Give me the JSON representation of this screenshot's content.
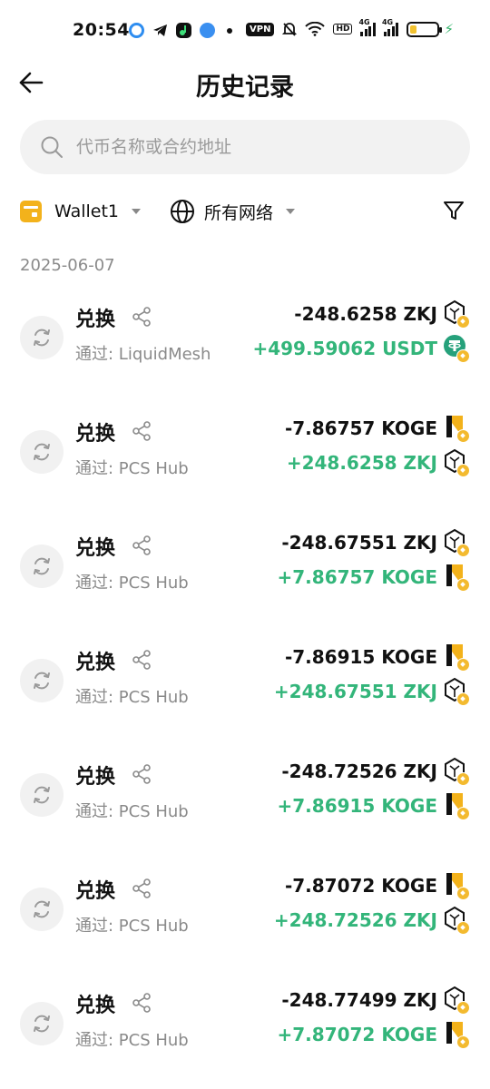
{
  "status_bar": {
    "time": "20:54",
    "vpn": "VPN",
    "hd": "HD",
    "net1": "4G",
    "net2": "4G"
  },
  "header": {
    "title": "历史记录"
  },
  "search": {
    "placeholder": "代币名称或合约地址"
  },
  "filters": {
    "wallet": "Wallet1",
    "network": "所有网络"
  },
  "date_group": "2025-06-07",
  "colors": {
    "positive": "#33b57a",
    "bnb": "#f3ba2f",
    "usdt": "#26a17b"
  },
  "transactions": [
    {
      "type": "兑换",
      "via": "通过: LiquidMesh",
      "out": "-248.6258 ZKJ",
      "out_icon": "zkj-icon",
      "in": "+499.59062 USDT",
      "in_icon": "usdt-icon"
    },
    {
      "type": "兑换",
      "via": "通过: PCS Hub",
      "out": "-7.86757 KOGE",
      "out_icon": "koge-icon",
      "in": "+248.6258 ZKJ",
      "in_icon": "zkj-icon"
    },
    {
      "type": "兑换",
      "via": "通过: PCS Hub",
      "out": "-248.67551 ZKJ",
      "out_icon": "zkj-icon",
      "in": "+7.86757 KOGE",
      "in_icon": "koge-icon"
    },
    {
      "type": "兑换",
      "via": "通过: PCS Hub",
      "out": "-7.86915 KOGE",
      "out_icon": "koge-icon",
      "in": "+248.67551 ZKJ",
      "in_icon": "zkj-icon"
    },
    {
      "type": "兑换",
      "via": "通过: PCS Hub",
      "out": "-248.72526 ZKJ",
      "out_icon": "zkj-icon",
      "in": "+7.86915 KOGE",
      "in_icon": "koge-icon"
    },
    {
      "type": "兑换",
      "via": "通过: PCS Hub",
      "out": "-7.87072 KOGE",
      "out_icon": "koge-icon",
      "in": "+248.72526 ZKJ",
      "in_icon": "zkj-icon"
    },
    {
      "type": "兑换",
      "via": "通过: PCS Hub",
      "out": "-248.77499 ZKJ",
      "out_icon": "zkj-icon",
      "in": "+7.87072 KOGE",
      "in_icon": "koge-icon"
    }
  ]
}
